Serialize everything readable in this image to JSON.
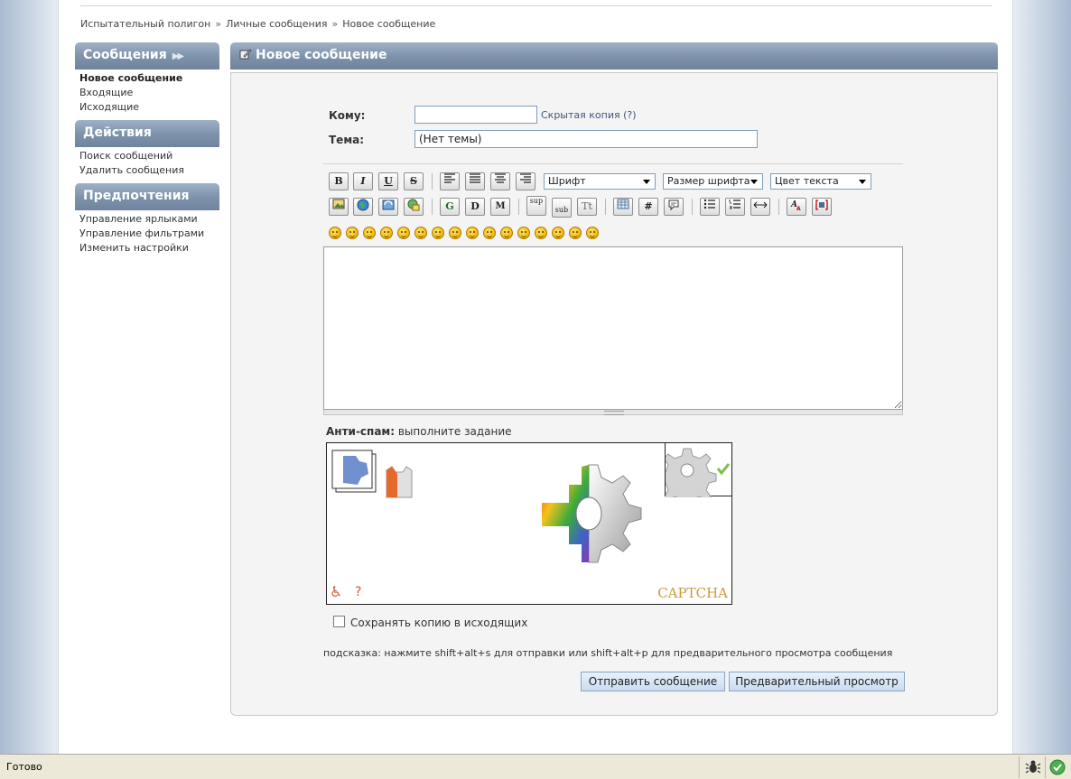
{
  "breadcrumb": {
    "items": [
      "Испытательный полигон",
      "Личные сообщения",
      "Новое сообщение"
    ],
    "separator": "»"
  },
  "sidebar": {
    "sections": [
      {
        "title": "Сообщения",
        "items": [
          "Новое сообщение",
          "Входящие",
          "Исходящие"
        ]
      },
      {
        "title": "Действия",
        "items": [
          "Поиск сообщений",
          "Удалить сообщения"
        ]
      },
      {
        "title": "Предпочтения",
        "items": [
          "Управление ярлыками",
          "Управление фильтрами",
          "Изменить настройки"
        ]
      }
    ]
  },
  "main": {
    "title": "Новое сообщение",
    "to_label": "Кому:",
    "to_value": "",
    "bcc_link": "Скрытая копия (?)",
    "subject_label": "Тема:",
    "subject_value": "(Нет темы)",
    "toolbar": {
      "font_select": "Шрифт",
      "size_select": "Размер шрифта",
      "color_select": "Цвет текста",
      "bold": "B",
      "italic": "I",
      "underline": "U",
      "strike": "S",
      "sup": "sup",
      "sub": "sub",
      "tt": "Tt",
      "hash": "#",
      "g": "G",
      "d": "D",
      "m": "M"
    },
    "antispam_label": "Анти-спам:",
    "antispam_text": "выполните задание",
    "captcha_brand": "CAPTCHA",
    "captcha_help": "?",
    "save_copy_label": "Сохранять копию в исходящих",
    "hint": "подсказка: нажмите shift+alt+s для отправки или shift+alt+p для предварительного просмотра сообщения",
    "send_button": "Отправить сообщение",
    "preview_button": "Предварительный просмотр"
  },
  "statusbar": {
    "text": "Готово"
  },
  "colors": {
    "header_gradient": "#7f94ac",
    "link": "#41577a",
    "button_bg": "#cbdcef"
  }
}
